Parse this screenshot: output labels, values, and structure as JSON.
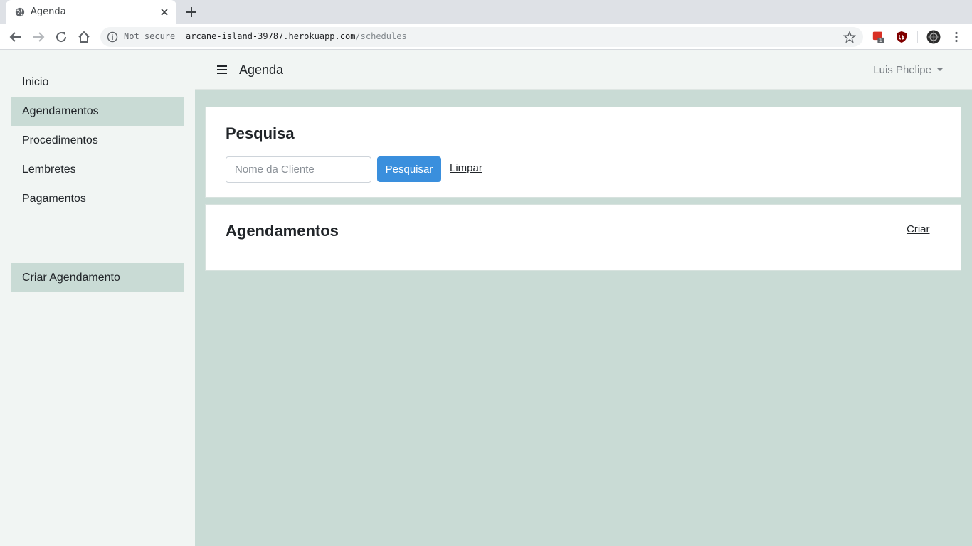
{
  "browser": {
    "tab_title": "Agenda",
    "security_label": "Not secure",
    "url_host": "arcane-island-39787.herokuapp.com",
    "url_path": "/schedules",
    "extension_badge": "1"
  },
  "sidebar": {
    "items": [
      {
        "label": "Inicio"
      },
      {
        "label": "Agendamentos",
        "active": true
      },
      {
        "label": "Procedimentos"
      },
      {
        "label": "Lembretes"
      },
      {
        "label": "Pagamentos"
      }
    ],
    "create_label": "Criar Agendamento"
  },
  "topbar": {
    "brand": "Agenda",
    "user_name": "Luis Phelipe"
  },
  "search_card": {
    "title": "Pesquisa",
    "input_placeholder": "Nome da Cliente",
    "input_value": "",
    "search_button": "Pesquisar",
    "clear_link": "Limpar"
  },
  "list_card": {
    "title": "Agendamentos",
    "create_link": "Criar"
  },
  "colors": {
    "accent": "#3a8fdd",
    "sidebar_bg": "#f1f5f3",
    "active_item_bg": "#c9dbd5",
    "main_bg": "#c9dbd5"
  }
}
